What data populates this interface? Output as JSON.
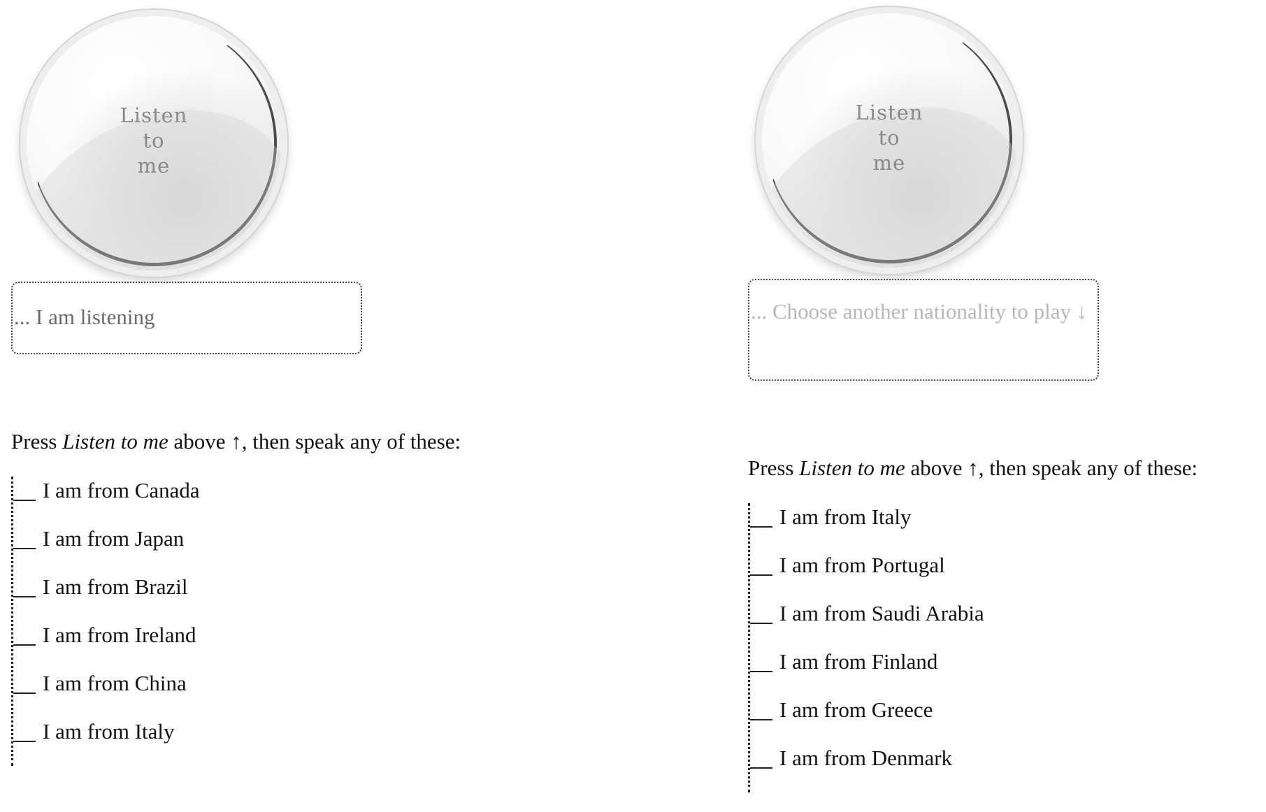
{
  "left_panel": {
    "button_label": "Listen\nto\nme",
    "status_text": "... I am listening",
    "instructions": {
      "prefix": "Press ",
      "emphasis": "Listen to me",
      "suffix": " above ↑, then speak any of these:"
    },
    "phrases": [
      "I am from Canada",
      "I am from Japan",
      "I am from Brazil",
      "I am from Ireland",
      "I am from China",
      "I am from Italy"
    ]
  },
  "right_panel": {
    "button_label": "Listen\nto\nme",
    "status_text": "... Choose another nationality to play ↓",
    "instructions": {
      "prefix": "Press ",
      "emphasis": "Listen to me",
      "suffix": " above ↑, then speak any of these:"
    },
    "phrases": [
      "I am from Italy",
      "I am from Portugal",
      "I am from Saudi Arabia",
      "I am from Finland",
      "I am from Greece",
      "I am from Denmark"
    ]
  },
  "colors": {
    "status_active": "#6a6a6a",
    "status_inactive": "#b8b8b8",
    "button_text": "#8a8a8a"
  }
}
